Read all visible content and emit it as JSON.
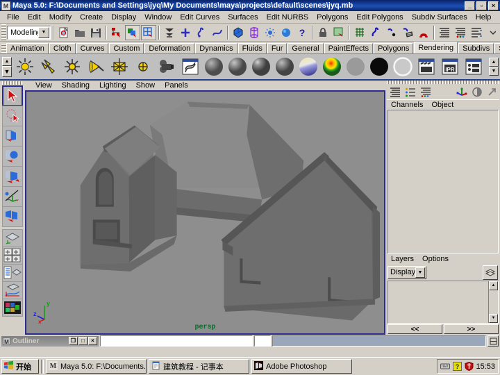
{
  "window": {
    "title": "Maya 5.0: F:\\Documents and Settings\\jyq\\My Documents\\maya\\projects\\default\\scenes\\jyq.mb",
    "app_icon": "maya-icon",
    "minimize": "_",
    "maximize": "▫",
    "close": "×"
  },
  "menubar": {
    "items": [
      {
        "label": "File"
      },
      {
        "label": "Edit"
      },
      {
        "label": "Modify"
      },
      {
        "label": "Create"
      },
      {
        "label": "Display"
      },
      {
        "label": "Window"
      },
      {
        "label": "Edit Curves"
      },
      {
        "label": "Surfaces"
      },
      {
        "label": "Edit NURBS"
      },
      {
        "label": "Polygons"
      },
      {
        "label": "Edit Polygons"
      },
      {
        "label": "Subdiv Surfaces"
      },
      {
        "label": "Help"
      }
    ]
  },
  "toolbar": {
    "menuset_value": "Modeling",
    "menuset_arrow": "▼",
    "buttons": [
      {
        "name": "new-scene-icon"
      },
      {
        "name": "open-scene-icon"
      },
      {
        "name": "save-scene-icon"
      },
      {
        "name": "hypergraph-icon"
      },
      {
        "name": "outliner-icon"
      },
      {
        "name": "multilister-icon"
      },
      {
        "name": "render-globals-icon"
      },
      {
        "name": "select-by-hierarchy-icon"
      },
      {
        "name": "select-by-object-icon"
      },
      {
        "name": "select-by-component-icon"
      },
      {
        "name": "highlight-icon"
      },
      {
        "name": "object-mode-icon"
      },
      {
        "name": "help-icon"
      },
      {
        "name": "lock-icon"
      },
      {
        "name": "render-region-icon"
      },
      {
        "name": "grid-snap-icon"
      },
      {
        "name": "curve-snap-icon"
      },
      {
        "name": "point-snap-icon"
      },
      {
        "name": "view-plane-snap-icon"
      },
      {
        "name": "magnet-snap-icon"
      },
      {
        "name": "construction-history-icon"
      },
      {
        "name": "render-current-frame-icon"
      },
      {
        "name": "ipr-render-icon"
      }
    ]
  },
  "shelf_tabs": {
    "tabs": [
      {
        "label": "Animation",
        "active": false
      },
      {
        "label": "Cloth",
        "active": false
      },
      {
        "label": "Curves",
        "active": false
      },
      {
        "label": "Custom",
        "active": false
      },
      {
        "label": "Deformation",
        "active": false
      },
      {
        "label": "Dynamics",
        "active": false
      },
      {
        "label": "Fluids",
        "active": false
      },
      {
        "label": "Fur",
        "active": false
      },
      {
        "label": "General",
        "active": false
      },
      {
        "label": "PaintEffects",
        "active": false
      },
      {
        "label": "Polygons",
        "active": false
      },
      {
        "label": "Rendering",
        "active": true
      },
      {
        "label": "Subdivs",
        "active": false
      },
      {
        "label": "Surfaces",
        "active": false
      }
    ],
    "trash_icon": "trash-icon"
  },
  "shelf": {
    "scroll_up": "▲",
    "scroll_down": "▼",
    "items": [
      {
        "name": "ambient-light-icon"
      },
      {
        "name": "directional-light-icon"
      },
      {
        "name": "point-light-icon"
      },
      {
        "name": "spot-light-icon"
      },
      {
        "name": "area-light-icon"
      },
      {
        "name": "volume-light-icon"
      },
      {
        "name": "camera-icon"
      },
      {
        "name": "hypershade-icon"
      },
      {
        "name": "lambert-material-sphere-icon"
      },
      {
        "name": "blinn-material-sphere-icon"
      },
      {
        "name": "phong-material-sphere-icon"
      },
      {
        "name": "anisotropic-material-sphere-icon"
      },
      {
        "name": "layered-shader-sphere-icon"
      },
      {
        "name": "ramp-shader-sphere-icon"
      },
      {
        "name": "surface-shader-sphere-icon"
      },
      {
        "name": "use-background-sphere-icon"
      },
      {
        "name": "shading-map-sphere-icon"
      },
      {
        "name": "render-frame-icon"
      },
      {
        "name": "ipr-render-frame-icon"
      },
      {
        "name": "render-globals-settings-icon"
      }
    ]
  },
  "toolbox": {
    "tools": [
      {
        "name": "select-tool",
        "selected": true
      },
      {
        "name": "lasso-select-tool",
        "selected": false
      },
      {
        "name": "paint-select-tool",
        "selected": false
      },
      {
        "name": "move-tool",
        "selected": false
      },
      {
        "name": "rotate-tool",
        "selected": false
      },
      {
        "name": "scale-tool",
        "selected": false
      },
      {
        "name": "universal-manipulator-tool",
        "selected": false
      },
      {
        "name": "soft-modification-tool",
        "selected": false
      }
    ],
    "layouts": [
      {
        "name": "single-perspective-layout"
      },
      {
        "name": "four-view-layout"
      },
      {
        "name": "outliner-persp-layout"
      },
      {
        "name": "persp-graph-layout"
      },
      {
        "name": "hypershade-persp-layout"
      }
    ]
  },
  "viewport": {
    "menu": [
      {
        "label": "View"
      },
      {
        "label": "Shading"
      },
      {
        "label": "Lighting"
      },
      {
        "label": "Show"
      },
      {
        "label": "Panels"
      }
    ],
    "camera_label": "persp",
    "axis": {
      "x": "x",
      "y": "y",
      "z": "z"
    },
    "background_color": "#8e8e8e",
    "border_color": "#2b2b8f",
    "scene_description": "shaded grey polygonal house model with pitched roofs, arched window and rectangular openings"
  },
  "channel_box": {
    "icons": [
      "channel-box-icon",
      "attribute-editor-icon",
      "tool-settings-icon",
      "axis-color-icon",
      "half-circle-icon",
      "arrow-icon"
    ],
    "menu": [
      {
        "label": "Channels"
      },
      {
        "label": "Object"
      }
    ],
    "content": ""
  },
  "layer_editor": {
    "menu": [
      {
        "label": "Layers"
      },
      {
        "label": "Options"
      }
    ],
    "display_value": "Display",
    "display_arrow": "▼",
    "new_layer_icon": "new-layer-icon",
    "scroll_up": "▲",
    "scroll_down": "▼",
    "prev_label": "<<",
    "next_label": ">>"
  },
  "status_line": {
    "outliner_title": "Outliner",
    "outliner_icon": "maya-icon",
    "win_restore": "❐",
    "win_max": "□",
    "win_close": "×",
    "command_value": "",
    "command_placeholder": "",
    "result_value": "",
    "help_line": "",
    "toggle_icon": "toggle-panel-icon"
  },
  "taskbar": {
    "start_label": "开始",
    "start_icon": "windows-flag-icon",
    "items": [
      {
        "label": "Maya 5.0: F:\\Documents...",
        "icon": "maya-icon"
      },
      {
        "label": "建筑教程 - 记事本",
        "icon": "notepad-icon"
      },
      {
        "label": "Adobe Photoshop",
        "icon": "photoshop-icon"
      }
    ],
    "tray": {
      "icons": [
        "keyboard-ime-icon",
        "help-question-icon",
        "antivirus-shield-icon"
      ],
      "clock": "15:53"
    }
  }
}
